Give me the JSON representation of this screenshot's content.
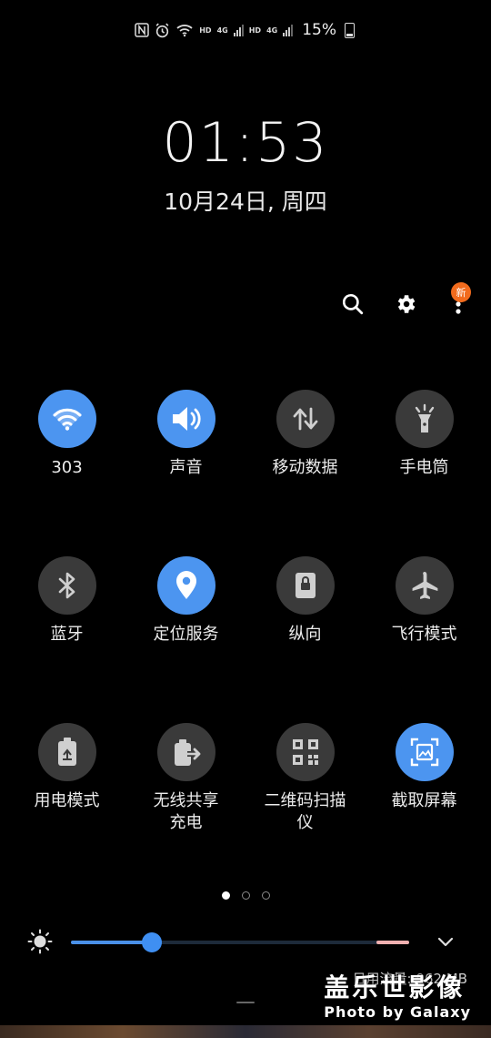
{
  "status_bar": {
    "hd1": "HD",
    "net1": "4G",
    "hd2": "HD",
    "net2": "4G",
    "battery": "15%",
    "icons": [
      "nfc-icon",
      "alarm-icon",
      "wifi-icon",
      "signal-icon",
      "signal-icon",
      "battery-charging-icon"
    ]
  },
  "clock": {
    "time": "01:53",
    "date": "10月24日, 周四"
  },
  "top_actions": {
    "badge": "新",
    "icons": [
      "search-icon",
      "gear-icon",
      "more-icon"
    ]
  },
  "tiles": [
    {
      "label": "303",
      "icon": "wifi-icon",
      "on": true
    },
    {
      "label": "声音",
      "icon": "volume-icon",
      "on": true
    },
    {
      "label": "移动数据",
      "icon": "mobile-data-icon",
      "on": false
    },
    {
      "label": "手电筒",
      "icon": "flashlight-icon",
      "on": false
    },
    {
      "label": "蓝牙",
      "icon": "bluetooth-icon",
      "on": false
    },
    {
      "label": "定位服务",
      "icon": "location-icon",
      "on": true
    },
    {
      "label": "纵向",
      "icon": "portrait-lock-icon",
      "on": false
    },
    {
      "label": "飞行模式",
      "icon": "airplane-icon",
      "on": false
    },
    {
      "label": "用电模式",
      "icon": "power-mode-icon",
      "on": false
    },
    {
      "label": "无线共享\n充电",
      "icon": "wireless-share-icon",
      "on": false
    },
    {
      "label": "二维码扫描\n仪",
      "icon": "qr-code-icon",
      "on": false
    },
    {
      "label": "截取屏幕",
      "icon": "screenshot-icon",
      "on": true
    }
  ],
  "pager": {
    "pages": 3,
    "active": 0
  },
  "brightness": {
    "level": 0.24,
    "icons": [
      "brightness-icon",
      "chevron-down-icon"
    ]
  },
  "data_usage": "日用流量: 962 MB",
  "watermark": {
    "title": "盖乐世影像",
    "sub": "Photo by Galaxy"
  },
  "colors": {
    "accent": "#4c95f0",
    "tile_off": "#3a3a3a",
    "badge": "#f26b1d"
  }
}
